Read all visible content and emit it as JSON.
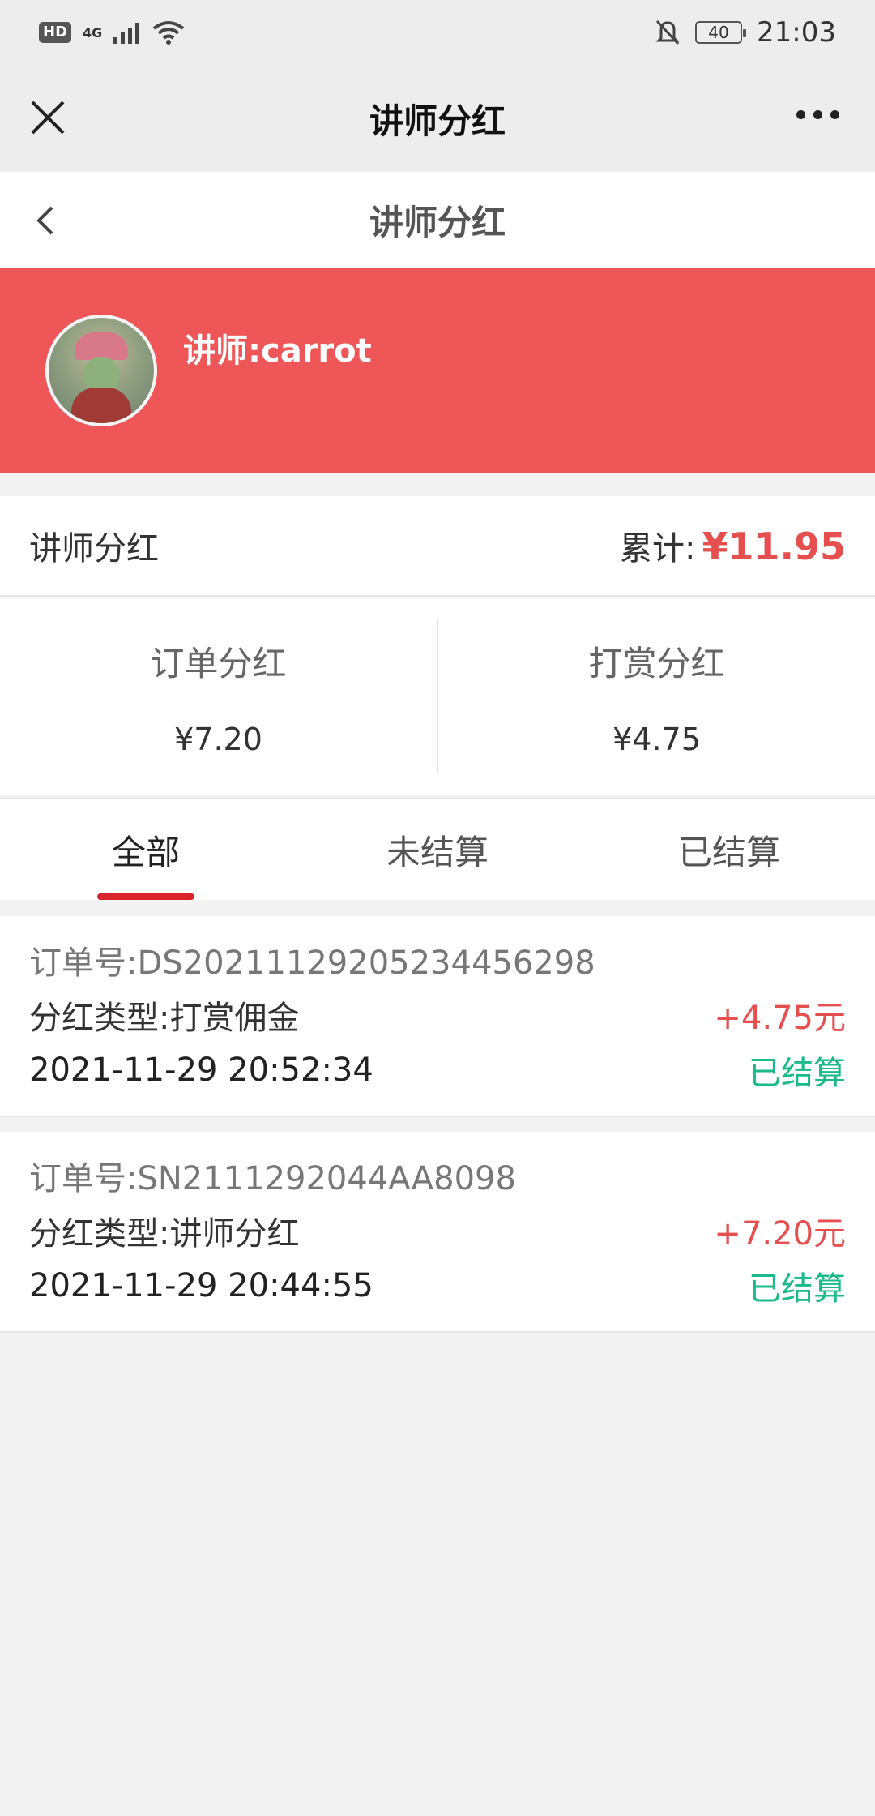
{
  "status_bar": {
    "hd": "HD",
    "network": "4G",
    "battery": "40",
    "time": "21:03"
  },
  "wechat_bar": {
    "title": "讲师分红",
    "close_icon": "close-icon",
    "more_icon": "more-icon"
  },
  "header": {
    "title": "讲师分红",
    "back_icon": "back-icon"
  },
  "banner": {
    "name": "讲师:carrot",
    "color": "#ee5657"
  },
  "summary": {
    "label": "讲师分红",
    "total_label": "累计:",
    "total_amount": "¥11.95"
  },
  "split": {
    "order_label": "订单分红",
    "order_value": "¥7.20",
    "reward_label": "打赏分红",
    "reward_value": "¥4.75"
  },
  "tabs": [
    {
      "label": "全部",
      "active": true
    },
    {
      "label": "未结算",
      "active": false
    },
    {
      "label": "已结算",
      "active": false
    }
  ],
  "records": [
    {
      "order_no": "订单号:DS20211129205234456298",
      "type": "分红类型:打赏佣金",
      "amount": "+4.75元",
      "time": "2021-11-29 20:52:34",
      "status": "已结算"
    },
    {
      "order_no": "订单号:SN2111292044AA8098",
      "type": "分红类型:讲师分红",
      "amount": "+7.20元",
      "time": "2021-11-29 20:44:55",
      "status": "已结算"
    }
  ],
  "colors": {
    "accent_red": "#e5504e",
    "settled_green": "#1aba8a",
    "tab_indicator": "#d8232d"
  }
}
